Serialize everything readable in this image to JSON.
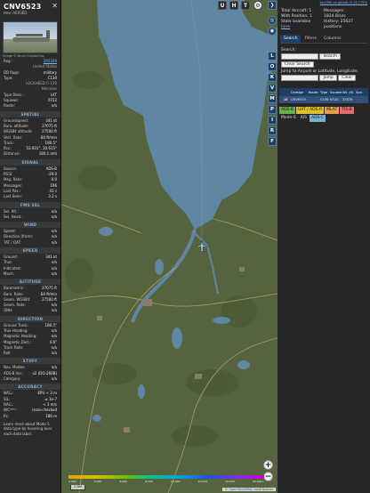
{
  "aircraft": {
    "callsign": "CNV6523",
    "hex_line": "Hex: AE93ED",
    "photo_caption": "Image © Bruni Clayton/lus",
    "details": [
      {
        "label": "Reg.:",
        "value": "165349",
        "link": true
      },
      {
        "label": "",
        "value": "United States",
        "sub": true
      },
      {
        "label": "DB flags:",
        "value": "military"
      },
      {
        "label": "Type:",
        "value": "C130"
      },
      {
        "label": "",
        "value": "LOCKHEED C-130",
        "sub": true
      },
      {
        "label": "",
        "value": "Hercules",
        "sub": true
      },
      {
        "label": "Type Desc.:",
        "value": "L4T"
      },
      {
        "label": "Squawk:",
        "value": "0722"
      },
      {
        "label": "Route:",
        "value": "n/a"
      }
    ],
    "sections": [
      {
        "title": "SPATIAL",
        "rows": [
          {
            "label": "Groundspeed:",
            "value": "341 kt"
          },
          {
            "label": "Baro. altitude:",
            "value": "27075 ft"
          },
          {
            "label": "WGS84 altitude:",
            "value": "27500 ft"
          },
          {
            "label": "Vert. Rate:",
            "value": "64 ft/min"
          },
          {
            "label": "Track:",
            "value": "180.5°"
          },
          {
            "label": "Pos.:",
            "value": "53.931°, 10.615°"
          },
          {
            "label": "Distance:",
            "value": "180.1 nmi"
          }
        ]
      },
      {
        "title": "SIGNAL",
        "rows": [
          {
            "label": "Source:",
            "value": "ADS-B"
          },
          {
            "label": "RSSI:",
            "value": "-29.0"
          },
          {
            "label": "Msg. Rate:",
            "value": "0.0"
          },
          {
            "label": "Messages:",
            "value": "196"
          },
          {
            "label": "Last Pos.:",
            "value": "41 s"
          },
          {
            "label": "Last Seen:",
            "value": "3.2 s"
          }
        ]
      },
      {
        "title": "FMS SEL",
        "rows": [
          {
            "label": "Sel. Alt.:",
            "value": "n/a"
          },
          {
            "label": "Sel. Head.:",
            "value": "n/a"
          }
        ]
      },
      {
        "title": "WIND",
        "rows": [
          {
            "label": "Speed:",
            "value": "n/a"
          },
          {
            "label": "Direction (from):",
            "value": "n/a"
          },
          {
            "label": "TAT / OAT:",
            "value": "n/a"
          }
        ]
      },
      {
        "title": "SPEED",
        "rows": [
          {
            "label": "Ground:",
            "value": "341 kt"
          },
          {
            "label": "True:",
            "value": "n/a"
          },
          {
            "label": "Indicated:",
            "value": "n/a"
          },
          {
            "label": "Mach:",
            "value": "n/a"
          }
        ]
      },
      {
        "title": "ALTITUDE",
        "rows": [
          {
            "label": "Barometric:",
            "value": "27075 ft"
          },
          {
            "label": "Baro. Rate:",
            "value": "64 ft/min"
          },
          {
            "label": "Geom. WGS84:",
            "value": "27500 ft"
          },
          {
            "label": "Geom. Rate:",
            "value": "n/a"
          },
          {
            "label": "QNH:",
            "value": "n/a"
          }
        ]
      },
      {
        "title": "DIRECTION",
        "rows": [
          {
            "label": "Ground Track:",
            "value": "180.5°"
          },
          {
            "label": "True Heading:",
            "value": "n/a"
          },
          {
            "label": "Magnetic Heading:",
            "value": "n/a"
          },
          {
            "label": "Magnetic Decl.:",
            "value": "4.6°"
          },
          {
            "label": "Track Rate:",
            "value": "n/a"
          },
          {
            "label": "Roll:",
            "value": "n/a"
          }
        ]
      },
      {
        "title": "STUFF",
        "rows": [
          {
            "label": "Nav. Modes:",
            "value": "n/a"
          },
          {
            "label": "ADS-B Ver.:",
            "value": "v2 (DO-260B)"
          },
          {
            "label": "Category:",
            "value": "n/a"
          }
        ]
      },
      {
        "title": "ACCURACY",
        "rows": [
          {
            "label": "NACₚ:",
            "value": "EPU < 3 m"
          },
          {
            "label": "SIL:",
            "value": "≤ 1e-7"
          },
          {
            "label": "NACᵥ:",
            "value": "< 3 m/s"
          },
          {
            "label": "NICᴮᴬᴿᴼ:",
            "value": "cross-checked"
          },
          {
            "label": "Rc:",
            "value": "186 m"
          }
        ]
      }
    ],
    "footer": "Learn more about Mode S data type by hovering over each data label."
  },
  "map": {
    "top_buttons": [
      "U",
      "H",
      "T"
    ],
    "legend_labels": [
      "2,000",
      "4,000",
      "6,000",
      "8,000",
      "10,000",
      "20,000",
      "30,000",
      "40,000+"
    ],
    "scale_label": "2 NM",
    "zoom_in": "+",
    "zoom_out": "−",
    "attribution_pre": "© ",
    "attribution_link": "OpenStreetMap",
    "attribution_post": " contributors.",
    "colors": {
      "water": "#5f86a3",
      "land": "#55633f",
      "aircraft": "#9ec7e8"
    }
  },
  "toolbar": {
    "buttons": [
      "L",
      "O",
      "K",
      "V",
      "M",
      "P",
      "I",
      "R",
      "F"
    ]
  },
  "sidebar": {
    "top_link": "tar1090 on github (3.14.1753)",
    "total_aircraft": "Total Aircraft: 1",
    "with_position": "With Position: 1",
    "stats_available": "Stats available",
    "stats_link": "here",
    "messages": "Messages: 1824.8/sec",
    "history": "History: 25627 positions",
    "tabs": [
      "Search",
      "Filters",
      "Columns"
    ],
    "search_label": "Search:",
    "search_button": "Search",
    "clear_search": "Clear Search",
    "jump_label": "Jump to Airport or Latitude, Longitude:",
    "jump_button": "Jump",
    "clear_button": "Clear",
    "table_headers": [
      "",
      "",
      "Callsign",
      "Route",
      "Type",
      "Squawk",
      "Alt. (ft)",
      "Spd."
    ],
    "table_rows": [
      {
        "flag": "🇺🇸",
        "callsign": "CNV6523",
        "route": "",
        "type": "C130",
        "squawk": "0722",
        "alt": "27075",
        "spd": ""
      }
    ],
    "sources": [
      {
        "label": "ADS-B",
        "color": "#6ab04c"
      },
      {
        "label": "UAT / ADS-R",
        "color": "#e0c030"
      },
      {
        "label": "MLAT",
        "color": "#e0a050"
      },
      {
        "label": "TIS-B",
        "color": "#e07070"
      },
      {
        "label": "Mode-S",
        "color": ""
      },
      {
        "label": "AIS",
        "color": ""
      },
      {
        "label": "ADS-C",
        "color": "#7cb0d0"
      }
    ]
  }
}
